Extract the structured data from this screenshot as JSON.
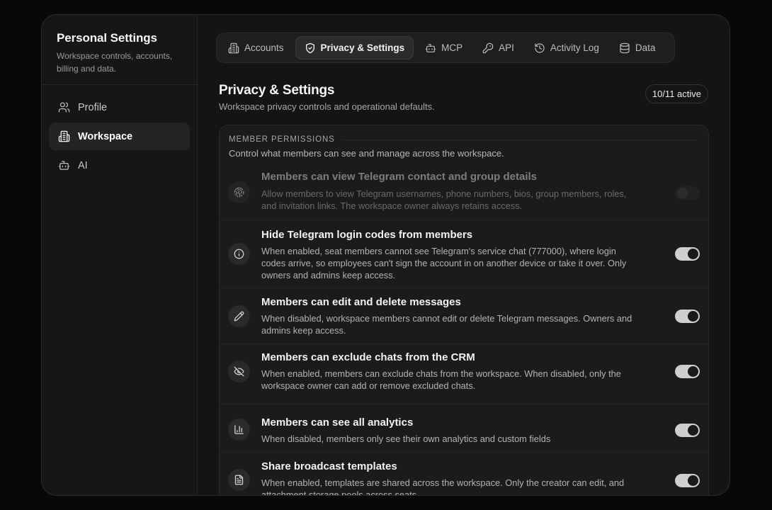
{
  "sidebar": {
    "title": "Personal Settings",
    "subtitle": "Workspace controls, accounts, billing and data.",
    "items": [
      {
        "label": "Profile",
        "icon": "users-icon",
        "active": false
      },
      {
        "label": "Workspace",
        "icon": "building-icon",
        "active": true
      },
      {
        "label": "AI",
        "icon": "bot-icon",
        "active": false
      }
    ]
  },
  "tabs": [
    {
      "label": "Accounts",
      "icon": "building-icon",
      "active": false
    },
    {
      "label": "Privacy & Settings",
      "icon": "shield-check-icon",
      "active": true
    },
    {
      "label": "MCP",
      "icon": "bot-icon",
      "active": false
    },
    {
      "label": "API",
      "icon": "key-icon",
      "active": false
    },
    {
      "label": "Activity Log",
      "icon": "history-icon",
      "active": false
    },
    {
      "label": "Data",
      "icon": "database-icon",
      "active": false
    }
  ],
  "page": {
    "title": "Privacy & Settings",
    "subtitle": "Workspace privacy controls and operational defaults.",
    "active_count": "10/11 active"
  },
  "section": {
    "label": "Member permissions",
    "description": "Control what members can see and manage across the workspace."
  },
  "settings": [
    {
      "title": "Members can view Telegram contact and group details",
      "description": "Allow members to view Telegram usernames, phone numbers, bios, group members, roles, and invitation links. The workspace owner always retains access.",
      "icon": "fingerprint-icon",
      "enabled": false,
      "disabled": true
    },
    {
      "title": "Hide Telegram login codes from members",
      "description": "When enabled, seat members cannot see Telegram's service chat (777000), where login codes arrive, so employees can't sign the account in on another device or take it over. Only owners and admins keep access.",
      "icon": "info-icon",
      "enabled": true,
      "disabled": false
    },
    {
      "title": "Members can edit and delete messages",
      "description": "When disabled, workspace members cannot edit or delete Telegram messages. Owners and admins keep access.",
      "icon": "pencil-icon",
      "enabled": true,
      "disabled": false
    },
    {
      "title": "Members can exclude chats from the CRM",
      "description": "When enabled, members can exclude chats from the workspace. When disabled, only the workspace owner can add or remove excluded chats.",
      "icon": "eye-off-icon",
      "enabled": true,
      "disabled": false
    },
    {
      "title": "Members can see all analytics",
      "description": "When disabled, members only see their own analytics and custom fields",
      "icon": "bar-chart-icon",
      "enabled": true,
      "disabled": false
    },
    {
      "title": "Share broadcast templates",
      "description": "When enabled, templates are shared across the workspace. Only the creator can edit, and attachment storage pools across seats.",
      "icon": "file-text-icon",
      "enabled": true,
      "disabled": false
    }
  ]
}
